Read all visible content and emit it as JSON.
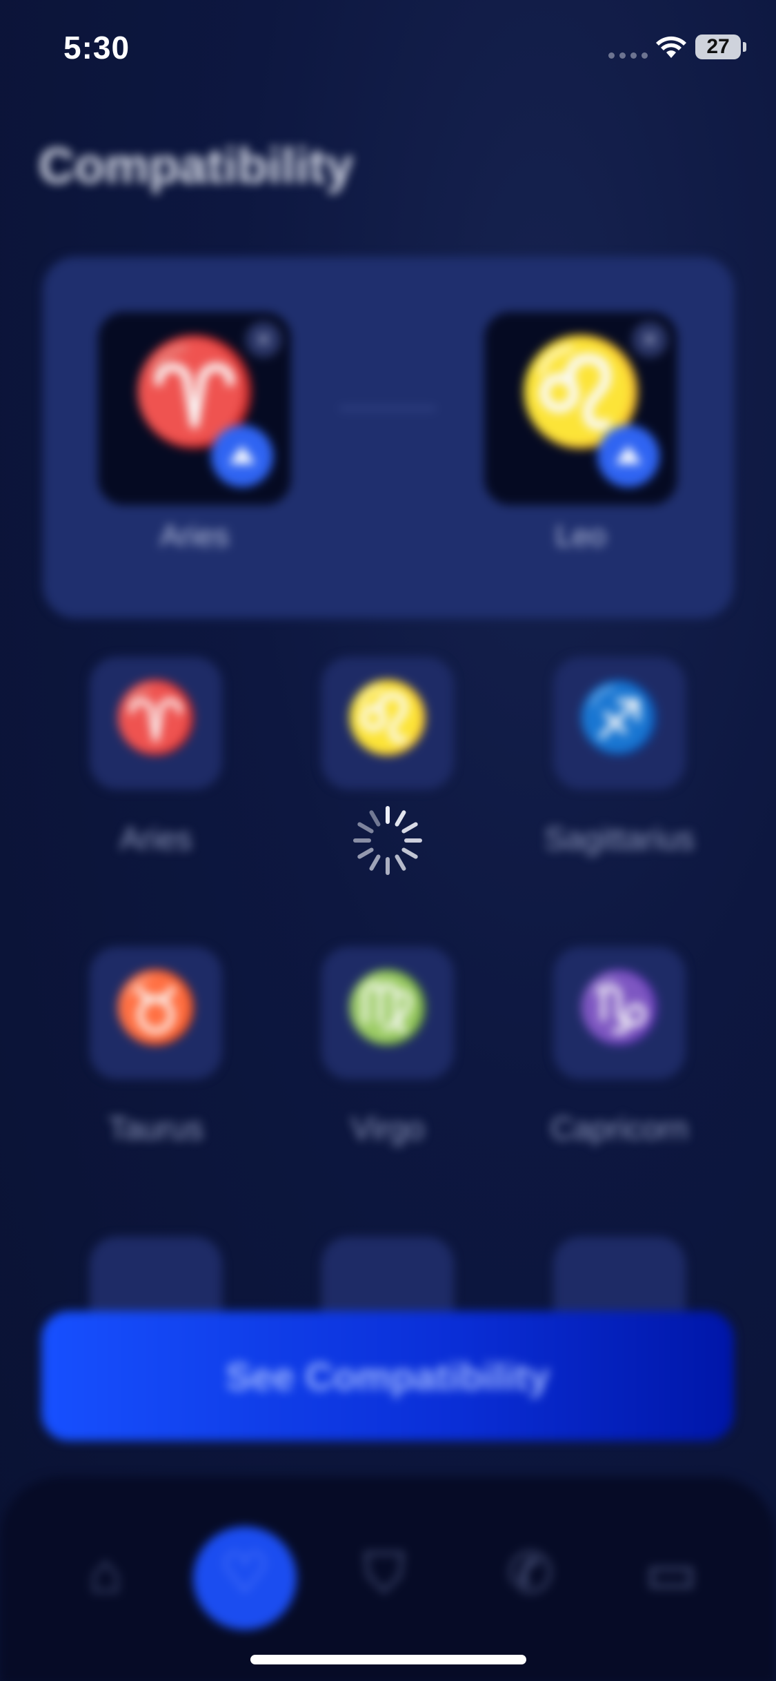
{
  "status_bar": {
    "time": "5:30",
    "battery": "27"
  },
  "page": {
    "title": "Compatibility"
  },
  "selected_pair": {
    "first": {
      "name": "Aries",
      "glyph": "♈",
      "icon": "aries-icon"
    },
    "second": {
      "name": "Leo",
      "glyph": "♌",
      "icon": "leo-icon"
    },
    "remove_glyph": "×"
  },
  "zodiac_grid": [
    {
      "name": "Aries",
      "glyph": "♈",
      "dates": "",
      "icon": "aries-icon"
    },
    {
      "name": "",
      "glyph": "♌",
      "dates": "",
      "icon": "leo-icon"
    },
    {
      "name": "Sagittarius",
      "glyph": "♐",
      "dates": "",
      "icon": "sagittarius-icon"
    },
    {
      "name": "Taurus",
      "glyph": "♉",
      "dates": "",
      "icon": "taurus-icon"
    },
    {
      "name": "Virgo",
      "glyph": "♍",
      "dates": "",
      "icon": "virgo-icon"
    },
    {
      "name": "Capricorn",
      "glyph": "♑",
      "dates": "",
      "icon": "capricorn-icon"
    }
  ],
  "cta": {
    "label": "See Compatibility"
  },
  "tabs": [
    {
      "glyph": "⌂",
      "icon": "home-icon",
      "active": false
    },
    {
      "glyph": "♡",
      "icon": "heart-icon",
      "active": true
    },
    {
      "glyph": "⛉",
      "icon": "shield-icon",
      "active": false
    },
    {
      "glyph": "✆",
      "icon": "phone-icon",
      "active": false
    },
    {
      "glyph": "▭",
      "icon": "cards-icon",
      "active": false
    }
  ]
}
